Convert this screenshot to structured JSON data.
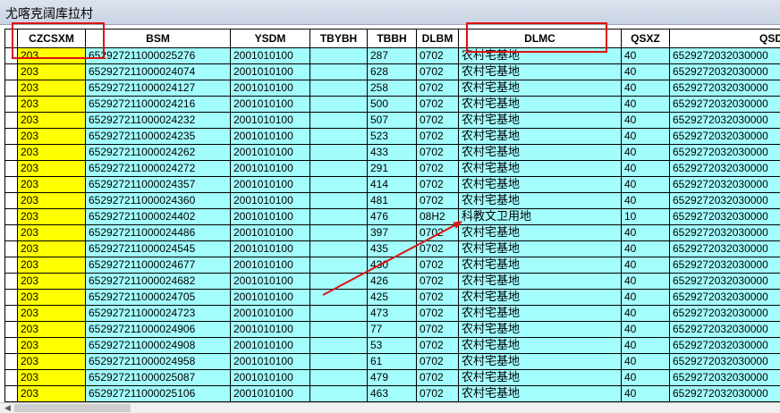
{
  "window": {
    "title": "尤喀克阔库拉村"
  },
  "grid": {
    "columns": [
      "CZCSXM",
      "BSM",
      "YSDM",
      "TBYBH",
      "TBBH",
      "DLBM",
      "DLMC",
      "QSXZ",
      "QSDWDM"
    ],
    "rows": [
      [
        "203",
        "652927211000025276",
        "2001010100",
        "",
        "287",
        "0702",
        "农村宅基地",
        "40",
        "6529272032030000"
      ],
      [
        "203",
        "652927211000024074",
        "2001010100",
        "",
        "628",
        "0702",
        "农村宅基地",
        "40",
        "6529272032030000"
      ],
      [
        "203",
        "652927211000024127",
        "2001010100",
        "",
        "258",
        "0702",
        "农村宅基地",
        "40",
        "6529272032030000"
      ],
      [
        "203",
        "652927211000024216",
        "2001010100",
        "",
        "500",
        "0702",
        "农村宅基地",
        "40",
        "6529272032030000"
      ],
      [
        "203",
        "652927211000024232",
        "2001010100",
        "",
        "507",
        "0702",
        "农村宅基地",
        "40",
        "6529272032030000"
      ],
      [
        "203",
        "652927211000024235",
        "2001010100",
        "",
        "523",
        "0702",
        "农村宅基地",
        "40",
        "6529272032030000"
      ],
      [
        "203",
        "652927211000024262",
        "2001010100",
        "",
        "433",
        "0702",
        "农村宅基地",
        "40",
        "6529272032030000"
      ],
      [
        "203",
        "652927211000024272",
        "2001010100",
        "",
        "291",
        "0702",
        "农村宅基地",
        "40",
        "6529272032030000"
      ],
      [
        "203",
        "652927211000024357",
        "2001010100",
        "",
        "414",
        "0702",
        "农村宅基地",
        "40",
        "6529272032030000"
      ],
      [
        "203",
        "652927211000024360",
        "2001010100",
        "",
        "481",
        "0702",
        "农村宅基地",
        "40",
        "6529272032030000"
      ],
      [
        "203",
        "652927211000024402",
        "2001010100",
        "",
        "476",
        "08H2",
        "科教文卫用地",
        "10",
        "6529272032030000"
      ],
      [
        "203",
        "652927211000024486",
        "2001010100",
        "",
        "397",
        "0702",
        "农村宅基地",
        "40",
        "6529272032030000"
      ],
      [
        "203",
        "652927211000024545",
        "2001010100",
        "",
        "435",
        "0702",
        "农村宅基地",
        "40",
        "6529272032030000"
      ],
      [
        "203",
        "652927211000024677",
        "2001010100",
        "",
        "430",
        "0702",
        "农村宅基地",
        "40",
        "6529272032030000"
      ],
      [
        "203",
        "652927211000024682",
        "2001010100",
        "",
        "426",
        "0702",
        "农村宅基地",
        "40",
        "6529272032030000"
      ],
      [
        "203",
        "652927211000024705",
        "2001010100",
        "",
        "425",
        "0702",
        "农村宅基地",
        "40",
        "6529272032030000"
      ],
      [
        "203",
        "652927211000024723",
        "2001010100",
        "",
        "473",
        "0702",
        "农村宅基地",
        "40",
        "6529272032030000"
      ],
      [
        "203",
        "652927211000024906",
        "2001010100",
        "",
        "77",
        "0702",
        "农村宅基地",
        "40",
        "6529272032030000"
      ],
      [
        "203",
        "652927211000024908",
        "2001010100",
        "",
        "53",
        "0702",
        "农村宅基地",
        "40",
        "6529272032030000"
      ],
      [
        "203",
        "652927211000024958",
        "2001010100",
        "",
        "61",
        "0702",
        "农村宅基地",
        "40",
        "6529272032030000"
      ],
      [
        "203",
        "652927211000025087",
        "2001010100",
        "",
        "479",
        "0702",
        "农村宅基地",
        "40",
        "6529272032030000"
      ],
      [
        "203",
        "652927211000025106",
        "2001010100",
        "",
        "463",
        "0702",
        "农村宅基地",
        "40",
        "6529272032030000"
      ]
    ]
  },
  "colors": {
    "cell_background": "#a3fdfd",
    "highlight_column": "#ffff00",
    "annotation": "#e01010"
  },
  "scrollbar": {
    "left_arrow_icon": "arrow-left-icon"
  }
}
